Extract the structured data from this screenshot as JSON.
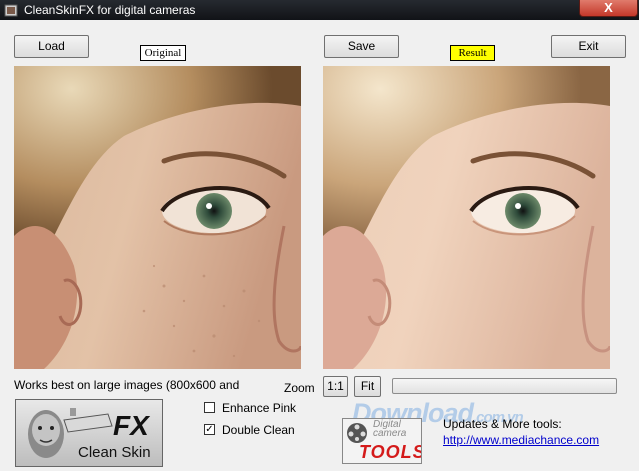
{
  "window": {
    "title": "CleanSkinFX for digital cameras",
    "close_label": "X"
  },
  "toolbar": {
    "load_label": "Load",
    "save_label": "Save",
    "exit_label": "Exit",
    "original_tag": "Original",
    "result_tag": "Result"
  },
  "colors": {
    "result_tag_bg": "#ffff00",
    "original_tag_bg": "#ffffff",
    "link": "#0000cc"
  },
  "info": {
    "hint": "Works best on large images (800x600 and",
    "zoom_label": "Zoom",
    "zoom_1to1": "1:1",
    "zoom_fit": "Fit",
    "progress": 0
  },
  "options": {
    "enhance_pink": {
      "label": "Enhance Pink",
      "checked": false
    },
    "double_clean": {
      "label": "Double Clean",
      "checked": true
    }
  },
  "branding": {
    "logo_fx": "FX",
    "logo_text": "Clean Skin",
    "dct_line1": "Digital",
    "dct_line2": "camera",
    "dct_tools": "TOOLS",
    "updates_label": "Updates & More tools:",
    "updates_url": "http://www.mediachance.com",
    "watermark_main": "Download",
    "watermark_suffix": ".com.vn"
  }
}
